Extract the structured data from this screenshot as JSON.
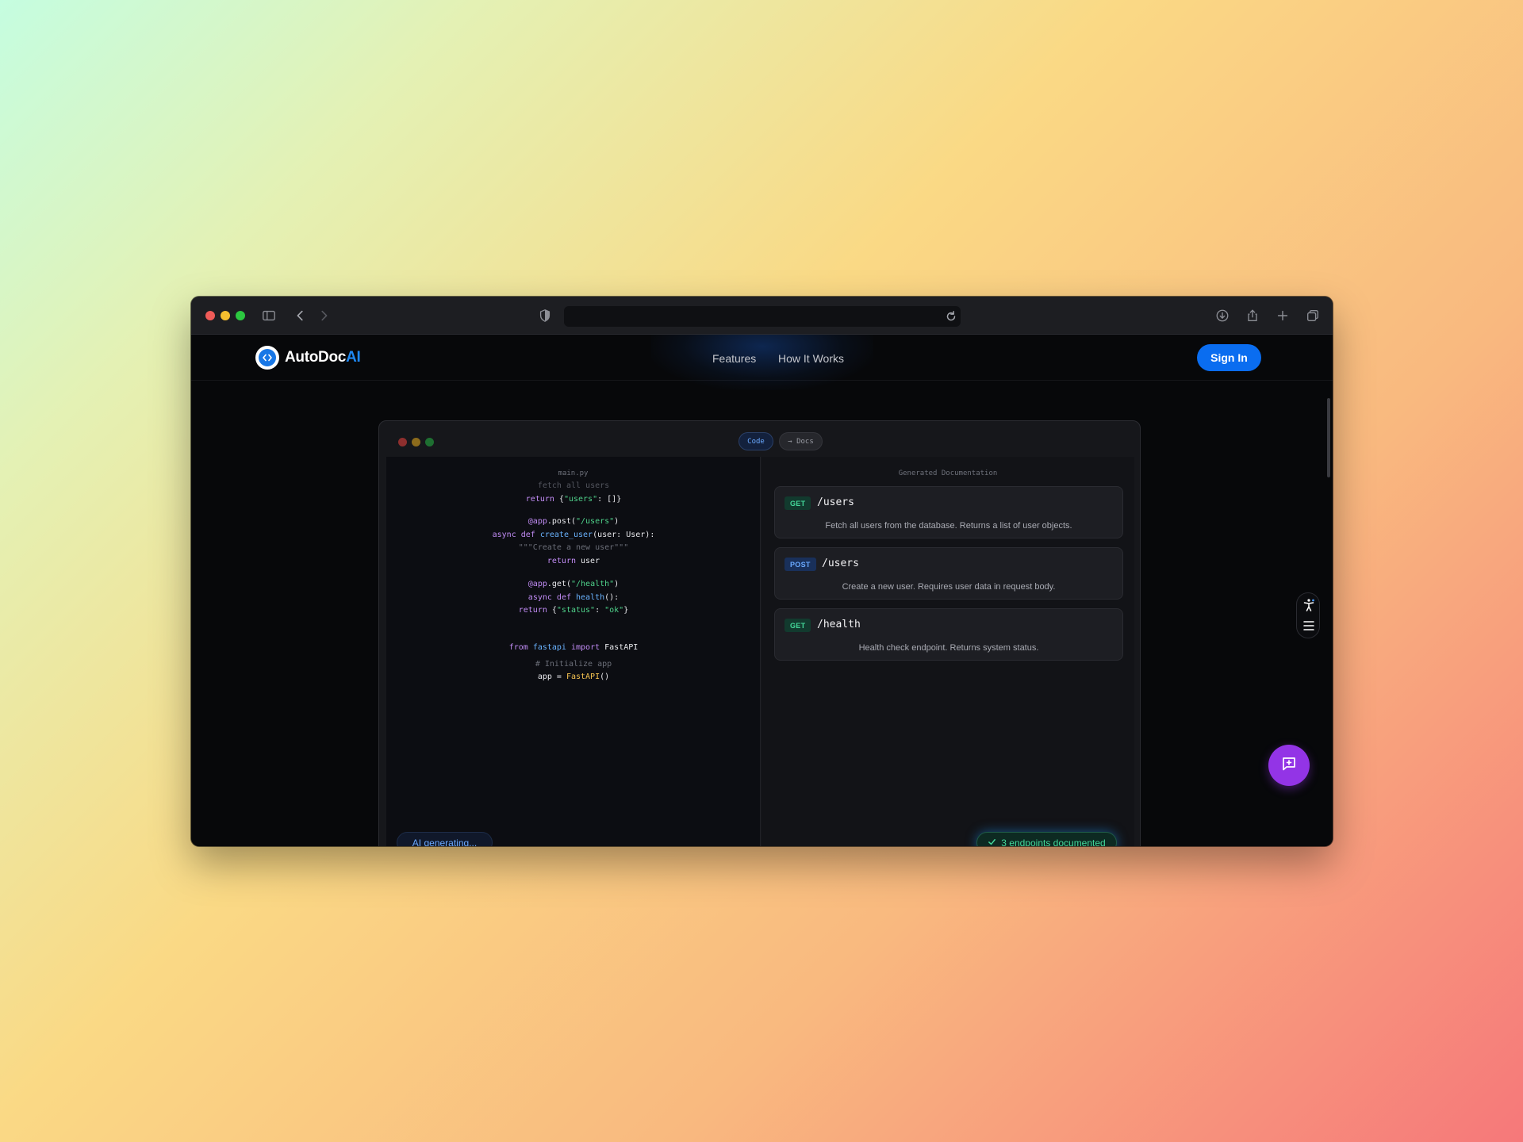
{
  "browser": {
    "url": ""
  },
  "nav": {
    "logo_main": "AutoDoc",
    "logo_accent": "AI",
    "links": [
      "Features",
      "How It Works"
    ],
    "signin_label": "Sign In"
  },
  "preview": {
    "tabs": [
      "Code",
      "→ Docs"
    ],
    "code": {
      "filename": "main.py",
      "lines": [
        "fetch all users",
        "return {\"users\": []}",
        "@app.post(\"/users\")",
        "async def create_user(user: User):",
        "\"\"\"Create a new user\"\"\"",
        "return user",
        "@app.get(\"/health\")",
        "async def health():",
        "return {\"status\": \"ok\"}",
        "from fastapi import FastAPI",
        "# Initialize app",
        "app = FastAPI()"
      ]
    },
    "docs": {
      "title": "Generated Documentation",
      "endpoints": [
        {
          "method": "GET",
          "path": "/users",
          "description": "Fetch all users from the database. Returns a list of user objects."
        },
        {
          "method": "POST",
          "path": "/users",
          "description": "Create a new user. Requires user data in request body."
        },
        {
          "method": "GET",
          "path": "/health",
          "description": "Health check endpoint. Returns system status."
        }
      ]
    },
    "status_generating": "AI generating...",
    "status_done": "3 endpoints documented"
  },
  "colors": {
    "accent": "#0a6df0",
    "get_badge": "#44d89a",
    "post_badge": "#6aa9ff",
    "chat_fab": "#9334e6"
  }
}
